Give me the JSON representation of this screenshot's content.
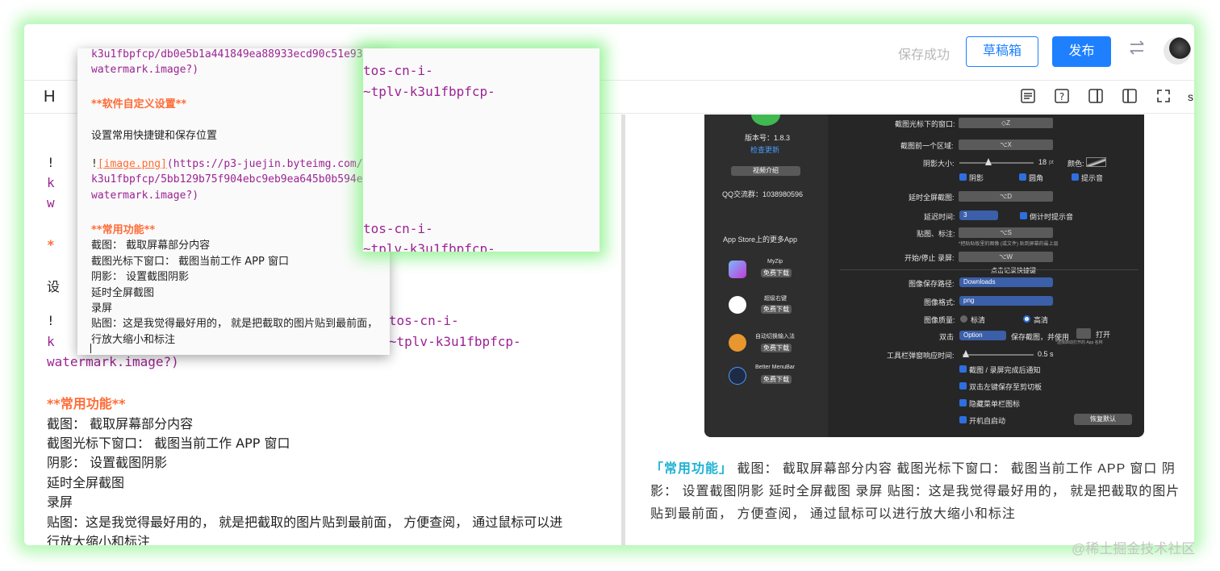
{
  "header": {
    "save_status": "保存成功",
    "drafts_label": "草稿箱",
    "publish_label": "发布",
    "switch_icon": "swap-arrows-icon",
    "avatar": "user-avatar"
  },
  "toolbar": {
    "heading_glyph": "H",
    "icons": [
      "lock-icon",
      "align-icon",
      "help-icon",
      "preview-right-icon",
      "preview-left-icon",
      "fullscreen-icon"
    ],
    "more_glyph": "s"
  },
  "editor": {
    "l1": "!",
    "l2": "k",
    "l3": "w",
    "l4": "*",
    "l5": "设",
    "l6_a": "!",
    "l6_b": "om/tos-cn-i-",
    "l7_a": "k",
    "l7_b": "94e~tplv-k3u1fbpfcp-",
    "l8": "watermark.image?)",
    "l9": "**常用功能**",
    "l10": "截图： 截取屏幕部分内容",
    "l11": "截图光标下窗口： 截图当前工作 APP 窗口",
    "l12": "阴影： 设置截图阴影",
    "l13": "延时全屏截图",
    "l14": "录屏",
    "l15": "贴图：这是我觉得最好用的， 就是把截取的图片贴到最前面， 方便查阅， 通过鼠标可以进",
    "l16": "行放大缩小和标注"
  },
  "popup_left": {
    "p1": "k3u1fbpfcp/db0e5b1a441849ea88933ecd90c51e93",
    "p2": "watermark.image?)",
    "p3": "**软件自定义设置**",
    "p4": "设置常用快捷键和保存位置",
    "p5_a": "!",
    "p5_b": "[image.png]",
    "p5_c": "(https://p3-juejin.byteimg.com/",
    "p6": "k3u1fbpfcp/5bb129b75f904ebc9eb9ea645b0b594e",
    "p7": "watermark.image?)",
    "p8": "**常用功能**",
    "p9": "截图： 截取屏幕部分内容",
    "p10": "截图光标下窗口： 截图当前工作 APP 窗口",
    "p11": "阴影： 设置截图阴影",
    "p12": "延时全屏截图",
    "p13": "录屏",
    "p14": "贴图：这是我觉得最好用的， 就是把截取的图片贴到最前面，",
    "p15": "行放大缩小和标注"
  },
  "popup_right": {
    "r1": "tos-cn-i-",
    "r2": "~tplv-k3u1fbpfcp-",
    "r3": "tos-cn-i-",
    "r4": "~tplv-k3u1fbpfcp-"
  },
  "mac_app": {
    "version": "版本号：1.8.3",
    "check_update": "检查更新",
    "video_intro": "视频介绍",
    "qq_group": "QQ交流群：1038980596",
    "more_apps": "App Store上的更多App",
    "apps": [
      {
        "name": "MyZip",
        "btn": "免费下载"
      },
      {
        "name": "超级右键",
        "btn": "免费下载"
      },
      {
        "name": "自动切换输入法",
        "btn": "免费下载"
      },
      {
        "name": "Better MenuBar",
        "btn": "免费下载"
      }
    ],
    "rows": {
      "cursor_window": "截图光标下的窗口:",
      "cursor_window_key": "◇Z",
      "prev_area": "截图前一个区域:",
      "prev_area_key": "⌥X",
      "shadow_size": "阴影大小:",
      "shadow_value": "18",
      "shadow_unit": "pt",
      "color": "颜色:",
      "check_shadow": "阴影",
      "check_round": "圆角",
      "check_sound": "提示音",
      "delay_full": "延时全屏截图:",
      "delay_full_key": "⌥D",
      "delay_time": "延迟时间:",
      "delay_time_value": "3",
      "countdown_sound": "倒计时提示音",
      "paste_mark": "贴图、标注:",
      "paste_mark_key": "⌥S",
      "paste_hint": "*把贴贴板里的图像 (或文件) 贴到屏幕的最上层",
      "record": "开始/停止 录屏:",
      "record_key": "⌥W",
      "record_shortcut": "点击记录快捷键",
      "save_path": "图像保存路径:",
      "save_path_value": "Downloads",
      "format": "图像格式:",
      "format_value": "png",
      "quality": "图像质量:",
      "quality_normal": "标清",
      "quality_high": "高清",
      "double_click": "双击",
      "double_click_option": "Option",
      "double_click_action": "保存截图，并使用",
      "open": "打开",
      "open_hint": "*选择启动打开的 App 名称",
      "toolbar_delay": "工具栏弹窗响应时间:",
      "toolbar_delay_value": "0.5 s",
      "notify": "截图 / 录屏完成后通知",
      "dbl_left": "双击左键保存至剪切板",
      "hide_menubar": "隐藏菜单栏图标",
      "autostart": "开机自启动",
      "restore": "恢复默认"
    }
  },
  "preview": {
    "strong": "「常用功能」",
    "body": " 截图： 截取屏幕部分内容 截图光标下窗口： 截图当前工作 APP 窗口 阴影： 设置截图阴影 延时全屏截图 录屏 贴图：这是我觉得最好用的， 就是把截取的图片贴到最前面， 方便查阅， 通过鼠标可以进行放大缩小和标注"
  },
  "watermark": "@稀土掘金技术社区",
  "colors": {
    "accent": "#1e80ff",
    "markdown_heading": "#ff6c37",
    "markdown_link": "#9b2393",
    "preview_strong": "#1eb3d3",
    "glow": "#78f078"
  }
}
